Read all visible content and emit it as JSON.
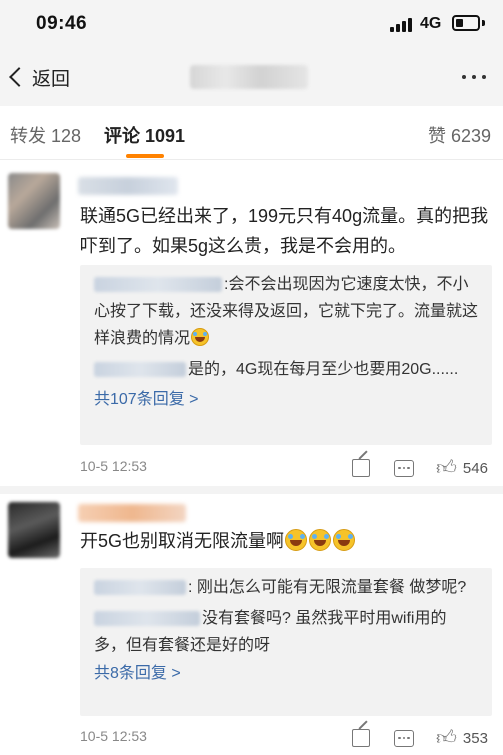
{
  "status_bar": {
    "time": "09:46",
    "network": "4G"
  },
  "nav": {
    "back_label": "返回"
  },
  "tabs": {
    "repost": "转发 128",
    "comments": "评论 1091",
    "likes": "赞 6239"
  },
  "comments": [
    {
      "text": "联通5G已经出来了，199元只有40g流量。真的把我吓到了。如果5g这么贵，我是不会用的。",
      "replies": [
        {
          "text": ":会不会出现因为它速度太快，不小心按了下载，还没来得及返回，它就下完了。流量就这样浪费的情况",
          "emoji": true
        },
        {
          "text": "是的，4G现在每月至少也要用20G......"
        }
      ],
      "more_replies": "共107条回复 >",
      "time": "10-5 12:53",
      "likes": "546"
    },
    {
      "text": "开5G也别取消无限流量啊",
      "emoji_count": 3,
      "replies": [
        {
          "text": ": 刚出怎么可能有无限流量套餐  做梦呢?"
        },
        {
          "text": "没有套餐吗? 虽然我平时用wifi用的多，但有套餐还是好的呀"
        }
      ],
      "more_replies": "共8条回复 >",
      "time": "10-5 12:53",
      "likes": "353"
    }
  ],
  "colors": {
    "accent": "#ff8200",
    "link": "#3b6aa8"
  },
  "icons": [
    "back-arrow-icon",
    "more-dots-icon",
    "share-icon",
    "reply-icon",
    "thumbs-up-icon",
    "laughing-emoji-icon"
  ]
}
